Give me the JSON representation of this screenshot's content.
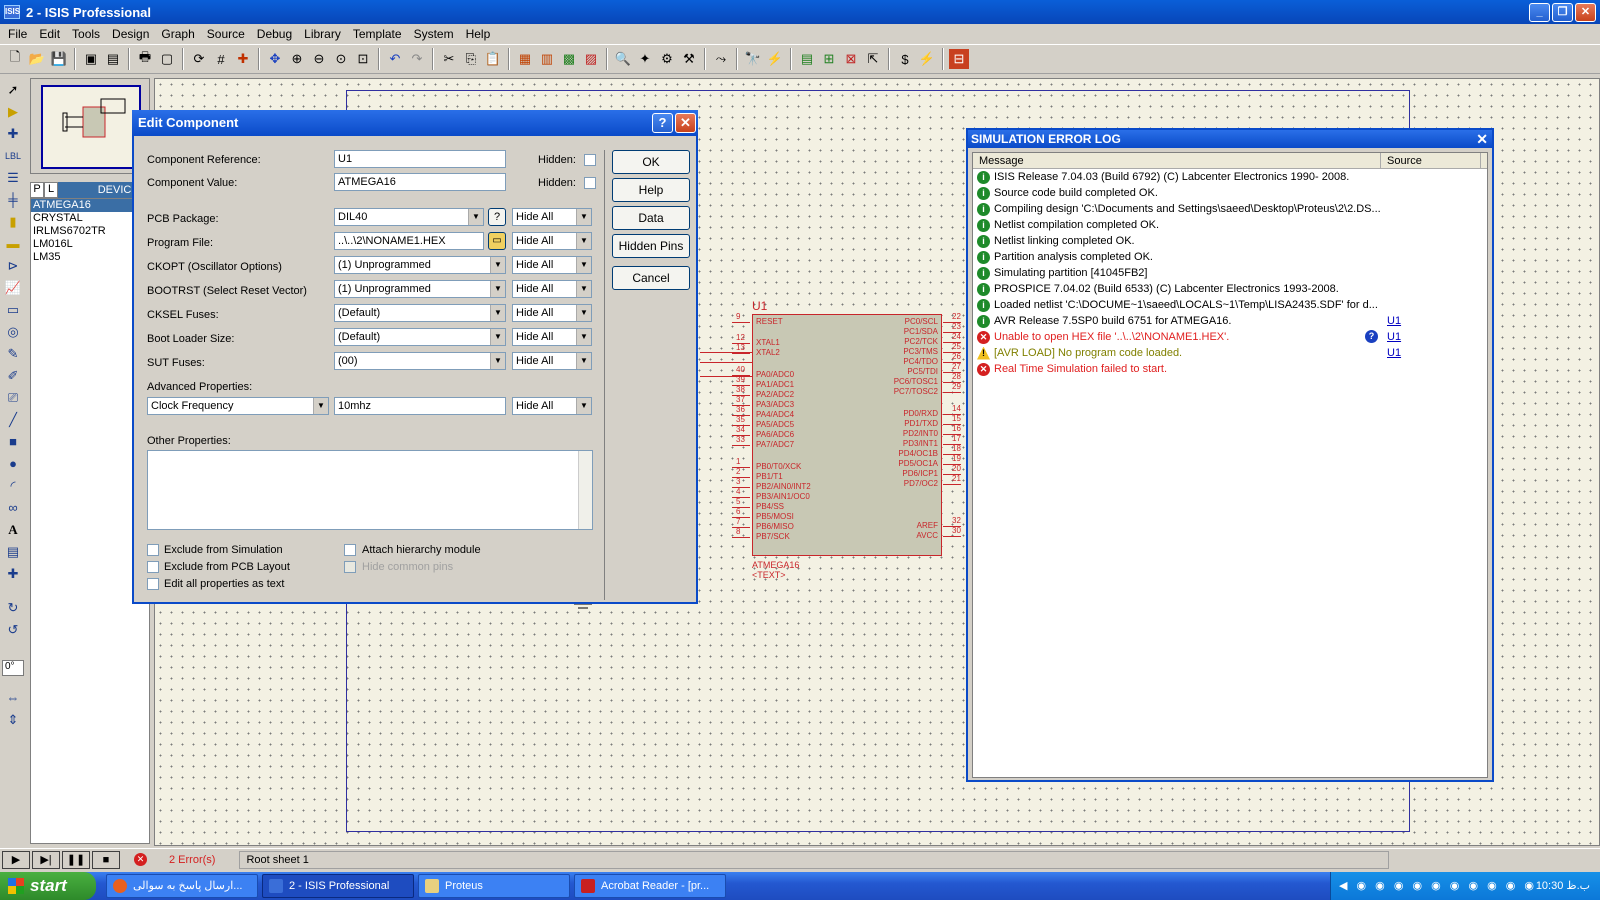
{
  "window": {
    "title": "2 - ISIS Professional",
    "app_icon": "ISIS"
  },
  "menu": [
    "File",
    "Edit",
    "Tools",
    "Design",
    "Graph",
    "Source",
    "Debug",
    "Library",
    "Template",
    "System",
    "Help"
  ],
  "devices": {
    "tab_p": "P",
    "tab_l": "L",
    "title": "DEVICES",
    "items": [
      "ATMEGA16",
      "CRYSTAL",
      "IRLMS6702TR",
      "LM016L",
      "LM35"
    ],
    "selected": "ATMEGA16"
  },
  "angle": "0°",
  "chip": {
    "ref": "U1",
    "part": "ATMEGA16",
    "text": "<TEXT>",
    "left_pins": [
      {
        "num": "9",
        "name": "RESET"
      },
      {
        "num": "12",
        "name": "XTAL1"
      },
      {
        "num": "13",
        "name": "XTAL2"
      },
      {
        "num": "40",
        "name": "PA0/ADC0"
      },
      {
        "num": "39",
        "name": "PA1/ADC1"
      },
      {
        "num": "38",
        "name": "PA2/ADC2"
      },
      {
        "num": "37",
        "name": "PA3/ADC3"
      },
      {
        "num": "36",
        "name": "PA4/ADC4"
      },
      {
        "num": "35",
        "name": "PA5/ADC5"
      },
      {
        "num": "34",
        "name": "PA6/ADC6"
      },
      {
        "num": "33",
        "name": "PA7/ADC7"
      },
      {
        "num": "1",
        "name": "PB0/T0/XCK"
      },
      {
        "num": "2",
        "name": "PB1/T1"
      },
      {
        "num": "3",
        "name": "PB2/AIN0/INT2"
      },
      {
        "num": "4",
        "name": "PB3/AIN1/OC0"
      },
      {
        "num": "5",
        "name": "PB4/SS"
      },
      {
        "num": "6",
        "name": "PB5/MOSI"
      },
      {
        "num": "7",
        "name": "PB6/MISO"
      },
      {
        "num": "8",
        "name": "PB7/SCK"
      }
    ],
    "right_pins": [
      {
        "num": "22",
        "name": "PC0/SCL"
      },
      {
        "num": "23",
        "name": "PC1/SDA"
      },
      {
        "num": "24",
        "name": "PC2/TCK"
      },
      {
        "num": "25",
        "name": "PC3/TMS"
      },
      {
        "num": "26",
        "name": "PC4/TDO"
      },
      {
        "num": "27",
        "name": "PC5/TDI"
      },
      {
        "num": "28",
        "name": "PC6/TOSC1"
      },
      {
        "num": "29",
        "name": "PC7/TOSC2"
      },
      {
        "num": "14",
        "name": "PD0/RXD"
      },
      {
        "num": "15",
        "name": "PD1/TXD"
      },
      {
        "num": "16",
        "name": "PD2/INT0"
      },
      {
        "num": "17",
        "name": "PD3/INT1"
      },
      {
        "num": "18",
        "name": "PD4/OC1B"
      },
      {
        "num": "19",
        "name": "PD5/OC1A"
      },
      {
        "num": "20",
        "name": "PD6/ICP1"
      },
      {
        "num": "21",
        "name": "PD7/OC2"
      },
      {
        "num": "32",
        "name": "AREF"
      },
      {
        "num": "30",
        "name": "AVCC"
      }
    ]
  },
  "edit_dialog": {
    "title": "Edit Component",
    "help_btn": "?",
    "close_btn": "✕",
    "ref_label": "Component Reference:",
    "ref_value": "U1",
    "val_label": "Component Value:",
    "val_value": "ATMEGA16",
    "hidden_label": "Hidden:",
    "pcb_label": "PCB Package:",
    "pcb_value": "DIL40",
    "pcb_q": "?",
    "prog_label": "Program File:",
    "prog_value": "..\\..\\2\\NONAME1.HEX",
    "ckopt_label": "CKOPT (Oscillator Options)",
    "ckopt_value": "(1) Unprogrammed",
    "bootrst_label": "BOOTRST (Select Reset Vector)",
    "bootrst_value": "(1) Unprogrammed",
    "cksel_label": "CKSEL Fuses:",
    "cksel_value": "(Default)",
    "bootsize_label": "Boot Loader Size:",
    "bootsize_value": "(Default)",
    "sut_label": "SUT Fuses:",
    "sut_value": "(00)",
    "hide_all": "Hide All",
    "adv_label": "Advanced Properties:",
    "adv_prop": "Clock Frequency",
    "adv_value": "10mhz",
    "other_label": "Other Properties:",
    "chk_sim": "Exclude from Simulation",
    "chk_pcb": "Exclude from PCB Layout",
    "chk_text": "Edit all properties as text",
    "chk_hier": "Attach hierarchy module",
    "chk_hide": "Hide common pins",
    "btn_ok": "OK",
    "btn_help": "Help",
    "btn_data": "Data",
    "btn_hidden": "Hidden Pins",
    "btn_cancel": "Cancel"
  },
  "simlog": {
    "title": "SIMULATION ERROR LOG",
    "col_message": "Message",
    "col_source": "Source",
    "rows": [
      {
        "type": "ok",
        "text": "ISIS Release 7.04.03 (Build 6792) (C) Labcenter Electronics 1990- 2008.",
        "src": ""
      },
      {
        "type": "ok",
        "text": "Source code build completed OK.",
        "src": ""
      },
      {
        "type": "ok",
        "text": "Compiling design 'C:\\Documents and Settings\\saeed\\Desktop\\Proteus\\2\\2.DS...",
        "src": ""
      },
      {
        "type": "ok",
        "text": "Netlist compilation completed OK.",
        "src": ""
      },
      {
        "type": "ok",
        "text": "Netlist linking completed OK.",
        "src": ""
      },
      {
        "type": "ok",
        "text": "Partition analysis completed OK.",
        "src": ""
      },
      {
        "type": "ok",
        "text": "Simulating partition [41045FB2]",
        "src": ""
      },
      {
        "type": "ok",
        "text": "PROSPICE 7.04.02 (Build 6533) (C) Labcenter Electronics 1993-2008.",
        "src": ""
      },
      {
        "type": "ok",
        "text": "Loaded netlist 'C:\\DOCUME~1\\saeed\\LOCALS~1\\Temp\\LISA2435.SDF' for d...",
        "src": ""
      },
      {
        "type": "ok",
        "text": "AVR Release 7.5SP0 build 6751 for ATMEGA16.",
        "src": "U1"
      },
      {
        "type": "err",
        "text": "Unable to open HEX file '..\\..\\2\\NONAME1.HEX'.",
        "src": "U1",
        "q": "?"
      },
      {
        "type": "warn",
        "text": "[AVR LOAD] No program code loaded.",
        "src": "U1"
      },
      {
        "type": "err",
        "text": "Real Time Simulation failed to start.",
        "src": ""
      }
    ]
  },
  "status": {
    "errors": "2 Error(s)",
    "sheet": "Root sheet 1"
  },
  "taskbar": {
    "start": "start",
    "tasks": [
      "ارسال پاسخ به سوالی...",
      "2 - ISIS Professional",
      "Proteus",
      "Acrobat Reader - [pr..."
    ],
    "clock": "10:30 ب.ظ"
  }
}
